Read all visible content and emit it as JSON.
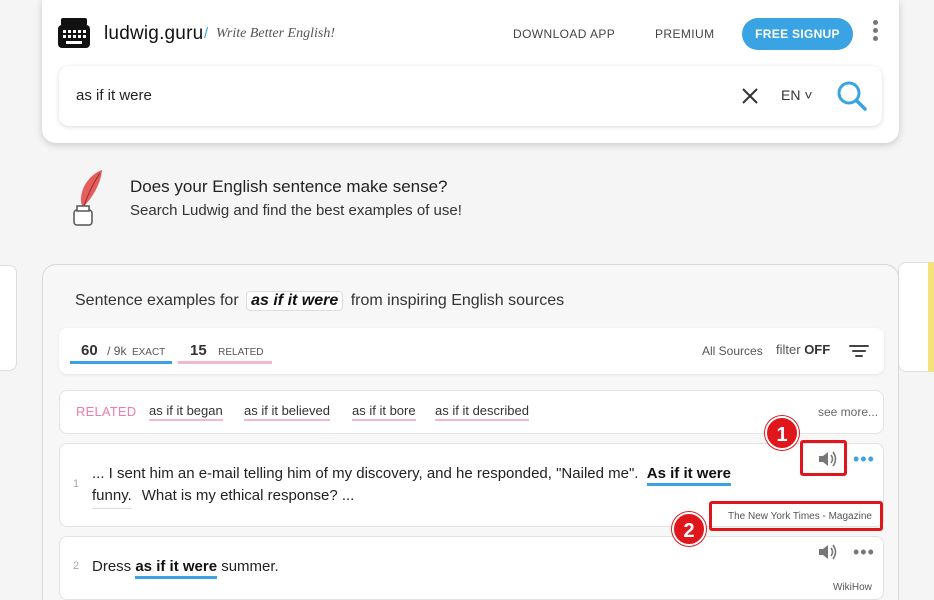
{
  "header": {
    "brand": "ludwig.guru",
    "separator": "/",
    "tagline": "Write Better English!",
    "nav_download": "DOWNLOAD APP",
    "nav_premium": "PREMIUM",
    "signup": "FREE SIGNUP"
  },
  "search": {
    "query": "as if it were",
    "language": "EN ˅"
  },
  "promo": {
    "title": "Does your English sentence make sense?",
    "subtitle": "Search Ludwig and find the best examples of use!"
  },
  "results": {
    "heading_prefix": "Sentence examples for",
    "heading_query": "as if it were",
    "heading_suffix": "from inspiring English sources",
    "exact_count": "60",
    "exact_total": "/ 9k",
    "exact_label": "EXACT",
    "related_count": "15",
    "related_label": "RELATED",
    "all_sources": "All Sources",
    "filter_label": "filter",
    "filter_state": "OFF"
  },
  "related": {
    "label": "RELATED",
    "items": [
      "as if it began",
      "as if it believed",
      "as if it bore",
      "as if it described"
    ],
    "see_more": "see more..."
  },
  "examples": [
    {
      "num": "1",
      "before": "... I sent him an e-mail telling him of my discovery, and he responded, \"Nailed me\".",
      "highlight": "As if it were",
      "line2_word": "funny.",
      "after": "What is my ethical response? ...",
      "source": "The New York Times - Magazine"
    },
    {
      "num": "2",
      "before": "Dress",
      "highlight": "as if it were",
      "after": "summer.",
      "source": "WikiHow"
    }
  ],
  "annotations": [
    "1",
    "2"
  ],
  "colors": {
    "accent": "#3aa3e3",
    "related_pink": "#f07cab",
    "annotation_red": "#e0161d"
  }
}
